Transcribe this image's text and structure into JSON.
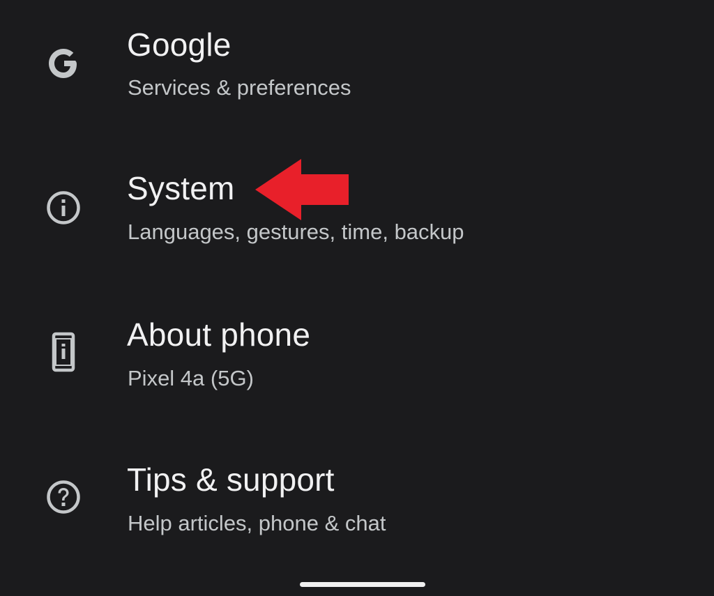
{
  "settings": {
    "items": [
      {
        "icon": "google-g-icon",
        "title": "Google",
        "subtitle": "Services & preferences"
      },
      {
        "icon": "info-icon",
        "title": "System",
        "subtitle": "Languages, gestures, time, backup"
      },
      {
        "icon": "phone-info-icon",
        "title": "About phone",
        "subtitle": "Pixel 4a (5G)"
      },
      {
        "icon": "help-icon",
        "title": "Tips & support",
        "subtitle": "Help articles, phone & chat"
      }
    ]
  },
  "annotation": {
    "arrow_color": "#e8202a",
    "points_to": "System"
  },
  "colors": {
    "background": "#1b1b1d",
    "title": "#f1f1f2",
    "subtitle": "#c4c7c9",
    "icon": "#c4c7c9"
  }
}
